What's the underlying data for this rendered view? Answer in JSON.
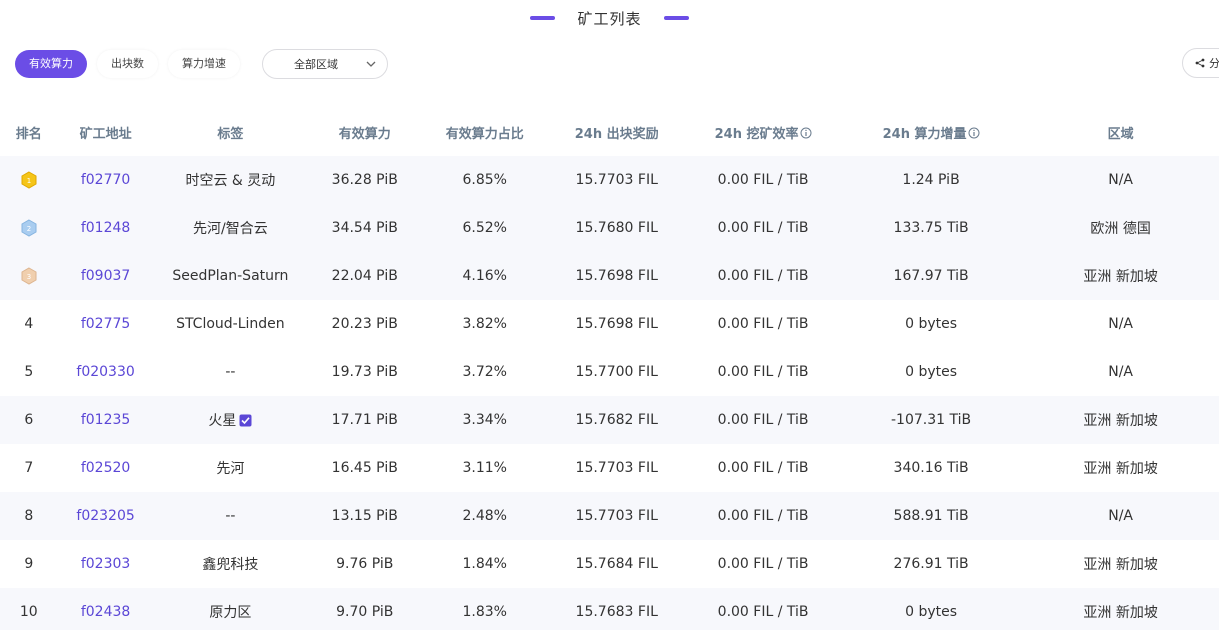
{
  "header": {
    "title": "矿工列表"
  },
  "filters": {
    "tabs": [
      {
        "label": "有效算力",
        "active": true
      },
      {
        "label": "出块数",
        "active": false
      },
      {
        "label": "算力增速",
        "active": false
      }
    ],
    "region": {
      "value": "全部区域",
      "icon": "chevron-down-icon"
    }
  },
  "share": {
    "label": "分",
    "icon": "share-icon"
  },
  "colors": {
    "accent": "#6b4de6",
    "link": "#5b47d6",
    "gold": "#f5c518",
    "silver": "#a9cdf0",
    "bronze": "#f0cfae"
  },
  "table": {
    "columns": [
      "排名",
      "矿工地址",
      "标签",
      "有效算力",
      "有效算力占比",
      "24h 出块奖励",
      "24h 挖矿效率",
      "24h 算力增量",
      "区域"
    ],
    "rows": [
      {
        "rank": "",
        "medal": "gold-medal-icon",
        "address": "f02770",
        "tag": "时空云 & 灵动",
        "power": "36.28 PiB",
        "share": "6.85%",
        "reward": "15.7703 FIL",
        "efficiency": "0.00 FIL / TiB",
        "increase": "1.24 PiB",
        "region": "N/A"
      },
      {
        "rank": "",
        "medal": "silver-medal-icon",
        "address": "f01248",
        "tag": "先河/智合云",
        "power": "34.54 PiB",
        "share": "6.52%",
        "reward": "15.7680 FIL",
        "efficiency": "0.00 FIL / TiB",
        "increase": "133.75 TiB",
        "region": "欧洲 德国"
      },
      {
        "rank": "",
        "medal": "bronze-medal-icon",
        "address": "f09037",
        "tag": "SeedPlan-Saturn",
        "power": "22.04 PiB",
        "share": "4.16%",
        "reward": "15.7698 FIL",
        "efficiency": "0.00 FIL / TiB",
        "increase": "167.97 TiB",
        "region": "亚洲 新加坡"
      },
      {
        "rank": "4",
        "address": "f02775",
        "tag": "STCloud-Linden",
        "power": "20.23 PiB",
        "share": "3.82%",
        "reward": "15.7698 FIL",
        "efficiency": "0.00 FIL / TiB",
        "increase": "0 bytes",
        "region": "N/A"
      },
      {
        "rank": "5",
        "address": "f020330",
        "tag": "--",
        "power": "19.73 PiB",
        "share": "3.72%",
        "reward": "15.7700 FIL",
        "efficiency": "0.00 FIL / TiB",
        "increase": "0 bytes",
        "region": "N/A"
      },
      {
        "rank": "6",
        "address": "f01235",
        "tag": "火星",
        "verified": true,
        "power": "17.71 PiB",
        "share": "3.34%",
        "reward": "15.7682 FIL",
        "efficiency": "0.00 FIL / TiB",
        "increase": "-107.31 TiB",
        "region": "亚洲 新加坡"
      },
      {
        "rank": "7",
        "address": "f02520",
        "tag": "先河",
        "power": "16.45 PiB",
        "share": "3.11%",
        "reward": "15.7703 FIL",
        "efficiency": "0.00 FIL / TiB",
        "increase": "340.16 TiB",
        "region": "亚洲 新加坡"
      },
      {
        "rank": "8",
        "address": "f023205",
        "tag": "--",
        "power": "13.15 PiB",
        "share": "2.48%",
        "reward": "15.7703 FIL",
        "efficiency": "0.00 FIL / TiB",
        "increase": "588.91 TiB",
        "region": "N/A"
      },
      {
        "rank": "9",
        "address": "f02303",
        "tag": "鑫兜科技",
        "power": "9.76 PiB",
        "share": "1.84%",
        "reward": "15.7684 FIL",
        "efficiency": "0.00 FIL / TiB",
        "increase": "276.91 TiB",
        "region": "亚洲 新加坡"
      },
      {
        "rank": "10",
        "address": "f02438",
        "tag": "原力区",
        "power": "9.70 PiB",
        "share": "1.83%",
        "reward": "15.7683 FIL",
        "efficiency": "0.00 FIL / TiB",
        "increase": "0 bytes",
        "region": "亚洲 新加坡"
      }
    ]
  }
}
